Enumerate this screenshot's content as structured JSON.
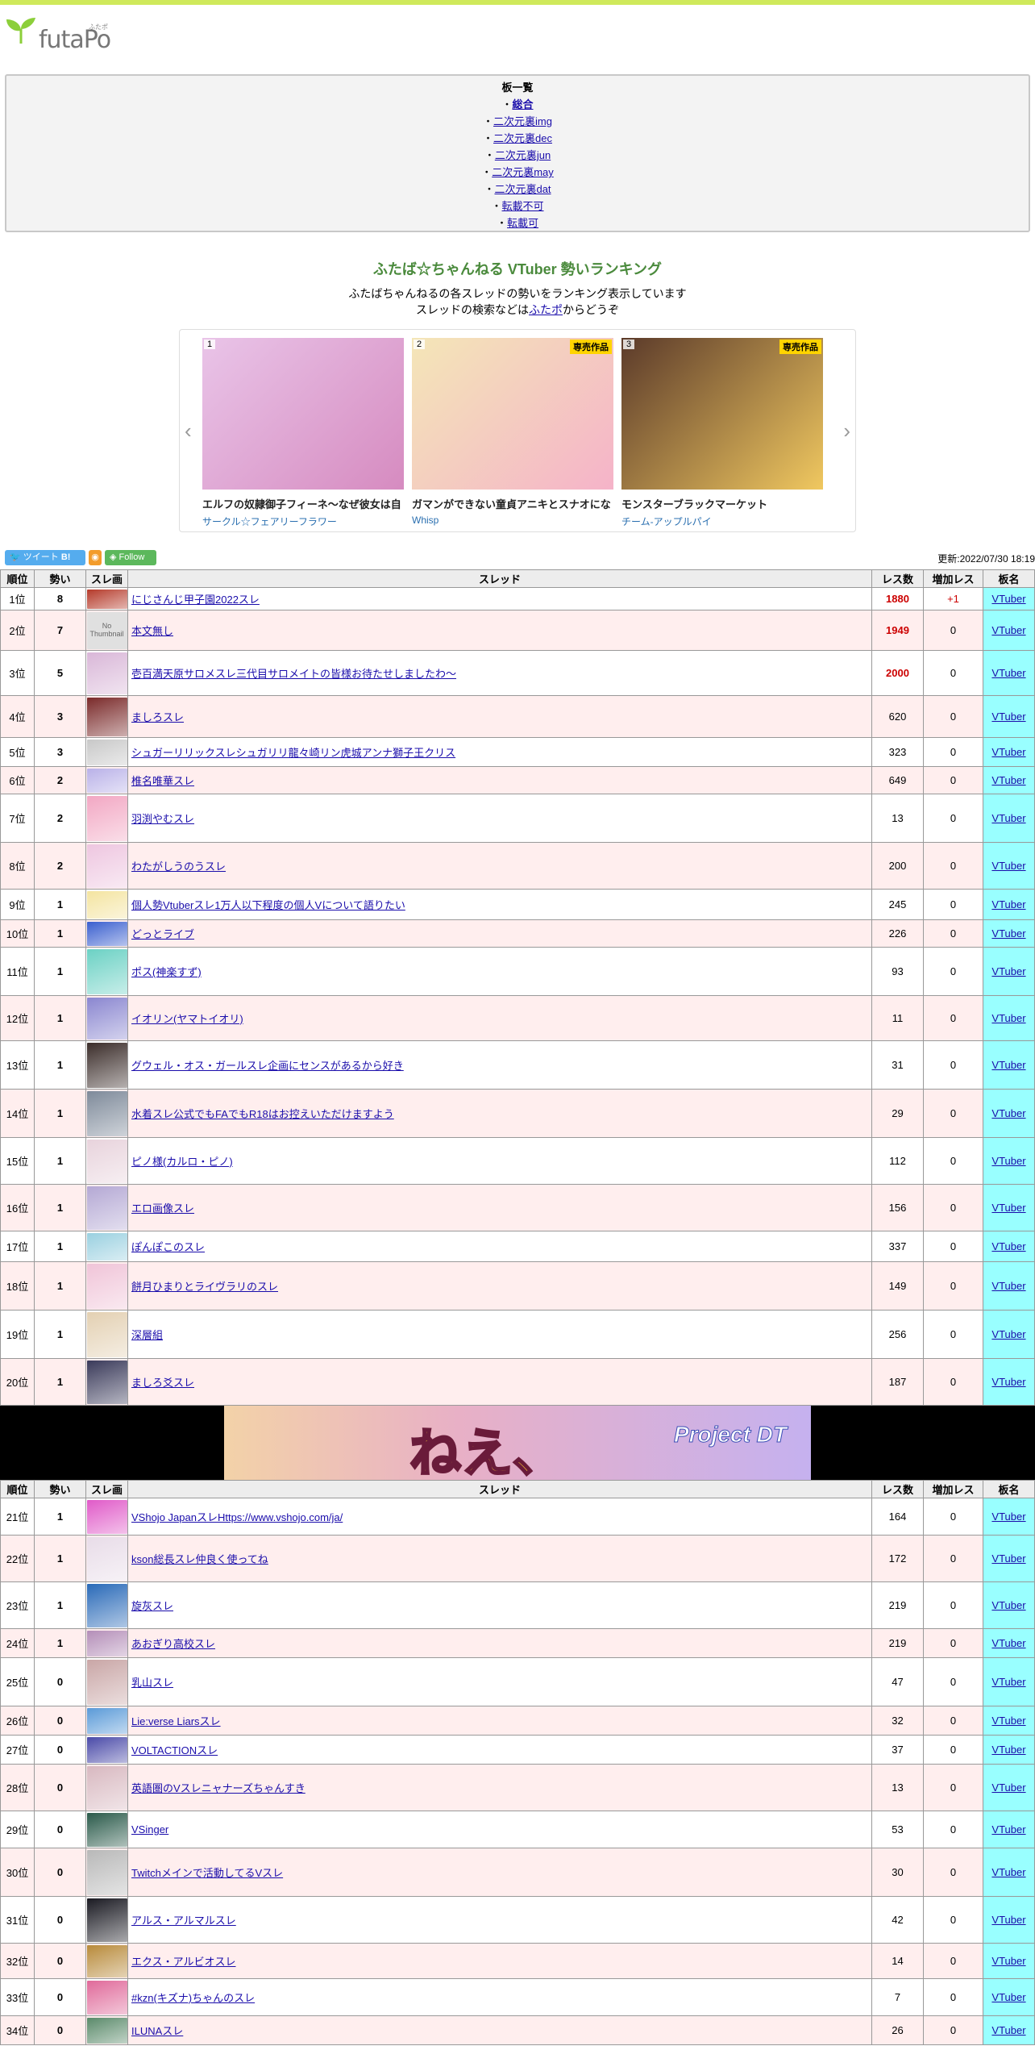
{
  "site": {
    "logo_text": "futaPo",
    "logo_ruby": "ふたポ"
  },
  "boards": {
    "heading": "板一覧",
    "items": [
      "総合",
      "二次元裏img",
      "二次元裏dec",
      "二次元裏jun",
      "二次元裏may",
      "二次元裏dat",
      "転載不可",
      "転載可"
    ]
  },
  "header": {
    "title": "ふたば☆ちゃんねる VTuber 勢いランキング",
    "line1": "ふたばちゃんねるの各スレッドの勢いをランキング表示しています",
    "line2_pre": "スレッドの検索などは",
    "line2_link": "ふたポ",
    "line2_post": "からどうぞ"
  },
  "carousel": [
    {
      "rank": "1",
      "badge": "",
      "title": "エルフの奴隷御子フィーネ～なぜ彼女は自",
      "circle": "サークル☆フェアリーフラワー",
      "colors": [
        "#e9c4e8",
        "#d68bc0"
      ]
    },
    {
      "rank": "2",
      "badge": "専売作品",
      "title": "ガマンができない童貞アニキとスナオにな",
      "circle": "Whisp",
      "colors": [
        "#f4e6b7",
        "#f5b3c9"
      ]
    },
    {
      "rank": "3",
      "badge": "専売作品",
      "title": "モンスターブラックマーケット",
      "circle": "チーム-アップルパイ",
      "colors": [
        "#5b3a2a",
        "#f0c860"
      ]
    }
  ],
  "social": {
    "tweet": "ツイート",
    "hatena": "B!",
    "follow": "Follow",
    "updated": "更新:2022/07/30 18:19"
  },
  "table": {
    "headers": [
      "順位",
      "勢い",
      "スレ画",
      "スレッド",
      "レス数",
      "増加レス",
      "板名"
    ],
    "rows": [
      {
        "rank": "1位",
        "mom": "8",
        "title": "にじさんじ甲子園2022スレ",
        "res": "1880",
        "inc": "+1",
        "board": "VTuber",
        "h": 28,
        "c": "#b53a2a",
        "hot": true
      },
      {
        "rank": "2位",
        "mom": "7",
        "title": "本文無し",
        "res": "1949",
        "inc": "0",
        "board": "VTuber",
        "h": 50,
        "c": "#dddddd",
        "hot": true,
        "nothumb": "No Thumbnail"
      },
      {
        "rank": "3位",
        "mom": "5",
        "title": "壱百満天原サロメスレ三代目サロメイトの皆様お待たせしましたわ〜",
        "res": "2000",
        "inc": "0",
        "board": "VTuber",
        "h": 56,
        "c": "#d9b7d8",
        "hot": true
      },
      {
        "rank": "4位",
        "mom": "3",
        "title": "ましろスレ",
        "res": "620",
        "inc": "0",
        "board": "VTuber",
        "h": 52,
        "c": "#7a2a2a"
      },
      {
        "rank": "5位",
        "mom": "3",
        "title": "シュガーリリックスレシュガリリ龍々崎リン虎城アンナ獅子王クリス",
        "res": "323",
        "inc": "0",
        "board": "VTuber",
        "h": 36,
        "c": "#c8c8c8"
      },
      {
        "rank": "6位",
        "mom": "2",
        "title": "椎名唯華スレ",
        "res": "649",
        "inc": "0",
        "board": "VTuber",
        "h": 34,
        "c": "#b9b1e8"
      },
      {
        "rank": "7位",
        "mom": "2",
        "title": "羽渕やむスレ",
        "res": "13",
        "inc": "0",
        "board": "VTuber",
        "h": 60,
        "c": "#f2a7c3"
      },
      {
        "rank": "8位",
        "mom": "2",
        "title": "わたがしうのうスレ",
        "res": "200",
        "inc": "0",
        "board": "VTuber",
        "h": 58,
        "c": "#eec6e0"
      },
      {
        "rank": "9位",
        "mom": "1",
        "title": "個人勢Vtuberスレ1万人以下程度の個人Vについて語りたい",
        "res": "245",
        "inc": "0",
        "board": "VTuber",
        "h": 38,
        "c": "#f4e4a0"
      },
      {
        "rank": "10位",
        "mom": "1",
        "title": "どっとライブ",
        "res": "226",
        "inc": "0",
        "board": "VTuber",
        "h": 34,
        "c": "#3a5fcf"
      },
      {
        "rank": "11位",
        "mom": "1",
        "title": "ポス(神楽すず)",
        "res": "93",
        "inc": "0",
        "board": "VTuber",
        "h": 60,
        "c": "#6bd1c4"
      },
      {
        "rank": "12位",
        "mom": "1",
        "title": "イオリン(ヤマトイオリ)",
        "res": "11",
        "inc": "0",
        "board": "VTuber",
        "h": 56,
        "c": "#8a86d0"
      },
      {
        "rank": "13位",
        "mom": "1",
        "title": "グウェル・オス・ガールスレ企画にセンスがあるから好き",
        "res": "31",
        "inc": "0",
        "board": "VTuber",
        "h": 60,
        "c": "#3b2d2a"
      },
      {
        "rank": "14位",
        "mom": "1",
        "title": "水着スレ公式でもFAでもR18はお控えいただけますよう",
        "res": "29",
        "inc": "0",
        "board": "VTuber",
        "h": 60,
        "c": "#7e8a9a"
      },
      {
        "rank": "15位",
        "mom": "1",
        "title": "ピノ様(カルロ・ピノ)",
        "res": "112",
        "inc": "0",
        "board": "VTuber",
        "h": 58,
        "c": "#e8d3dc"
      },
      {
        "rank": "16位",
        "mom": "1",
        "title": "エロ画像スレ",
        "res": "156",
        "inc": "0",
        "board": "VTuber",
        "h": 58,
        "c": "#b4a8d4"
      },
      {
        "rank": "17位",
        "mom": "1",
        "title": "ぽんぽこのスレ",
        "res": "337",
        "inc": "0",
        "board": "VTuber",
        "h": 38,
        "c": "#9ad0e0"
      },
      {
        "rank": "18位",
        "mom": "1",
        "title": "餅月ひまりとライヴラリのスレ",
        "res": "149",
        "inc": "0",
        "board": "VTuber",
        "h": 60,
        "c": "#f0c4d8"
      },
      {
        "rank": "19位",
        "mom": "1",
        "title": "深層組",
        "res": "256",
        "inc": "0",
        "board": "VTuber",
        "h": 60,
        "c": "#e3d0b2"
      },
      {
        "rank": "20位",
        "mom": "1",
        "title": "ましろ爻スレ",
        "res": "187",
        "inc": "0",
        "board": "VTuber",
        "h": 58,
        "c": "#3a3a5a"
      }
    ],
    "rows2": [
      {
        "rank": "21位",
        "mom": "1",
        "title": "VShojo JapanスレHttps://www.vshojo.com/ja/",
        "res": "164",
        "inc": "0",
        "board": "VTuber",
        "h": 46,
        "c": "#e05ac8"
      },
      {
        "rank": "22位",
        "mom": "1",
        "title": "kson総長スレ仲良く使ってね",
        "res": "172",
        "inc": "0",
        "board": "VTuber",
        "h": 58,
        "c": "#e8dce8"
      },
      {
        "rank": "23位",
        "mom": "1",
        "title": "旋灰スレ",
        "res": "219",
        "inc": "0",
        "board": "VTuber",
        "h": 58,
        "c": "#2a6ab8"
      },
      {
        "rank": "24位",
        "mom": "1",
        "title": "あおぎり高校スレ",
        "res": "219",
        "inc": "0",
        "board": "VTuber",
        "h": 36,
        "c": "#b48eb8"
      },
      {
        "rank": "25位",
        "mom": "0",
        "title": "乳山スレ",
        "res": "47",
        "inc": "0",
        "board": "VTuber",
        "h": 60,
        "c": "#c9a6a6"
      },
      {
        "rank": "26位",
        "mom": "0",
        "title": "Lie:verse Liarsスレ",
        "res": "32",
        "inc": "0",
        "board": "VTuber",
        "h": 36,
        "c": "#5a9ad8"
      },
      {
        "rank": "27位",
        "mom": "0",
        "title": "VOLTACTIONスレ",
        "res": "37",
        "inc": "0",
        "board": "VTuber",
        "h": 36,
        "c": "#4a4aa8"
      },
      {
        "rank": "28位",
        "mom": "0",
        "title": "英語圏のVスレニャナーズちゃんすき",
        "res": "13",
        "inc": "0",
        "board": "VTuber",
        "h": 58,
        "c": "#d8b8c0"
      },
      {
        "rank": "29位",
        "mom": "0",
        "title": "VSinger",
        "res": "53",
        "inc": "0",
        "board": "VTuber",
        "h": 46,
        "c": "#2a5a4a"
      },
      {
        "rank": "30位",
        "mom": "0",
        "title": "Twitchメインで活動してるVスレ",
        "res": "30",
        "inc": "0",
        "board": "VTuber",
        "h": 60,
        "c": "#b8b8b8"
      },
      {
        "rank": "31位",
        "mom": "0",
        "title": "アルス・アルマルスレ",
        "res": "42",
        "inc": "0",
        "board": "VTuber",
        "h": 58,
        "c": "#1a1a22"
      },
      {
        "rank": "32位",
        "mom": "0",
        "title": "エクス・アルビオスレ",
        "res": "14",
        "inc": "0",
        "board": "VTuber",
        "h": 44,
        "c": "#b88a3a"
      },
      {
        "rank": "33位",
        "mom": "0",
        "title": "#kzn(キズナ)ちゃんのスレ",
        "res": "7",
        "inc": "0",
        "board": "VTuber",
        "h": 46,
        "c": "#e06a9a"
      },
      {
        "rank": "34位",
        "mom": "0",
        "title": "ILUNAスレ",
        "res": "26",
        "inc": "0",
        "board": "VTuber",
        "h": 36,
        "c": "#5a8a6a"
      }
    ]
  },
  "ad": {
    "text1": "ねえ、",
    "text2": "Project DT"
  }
}
